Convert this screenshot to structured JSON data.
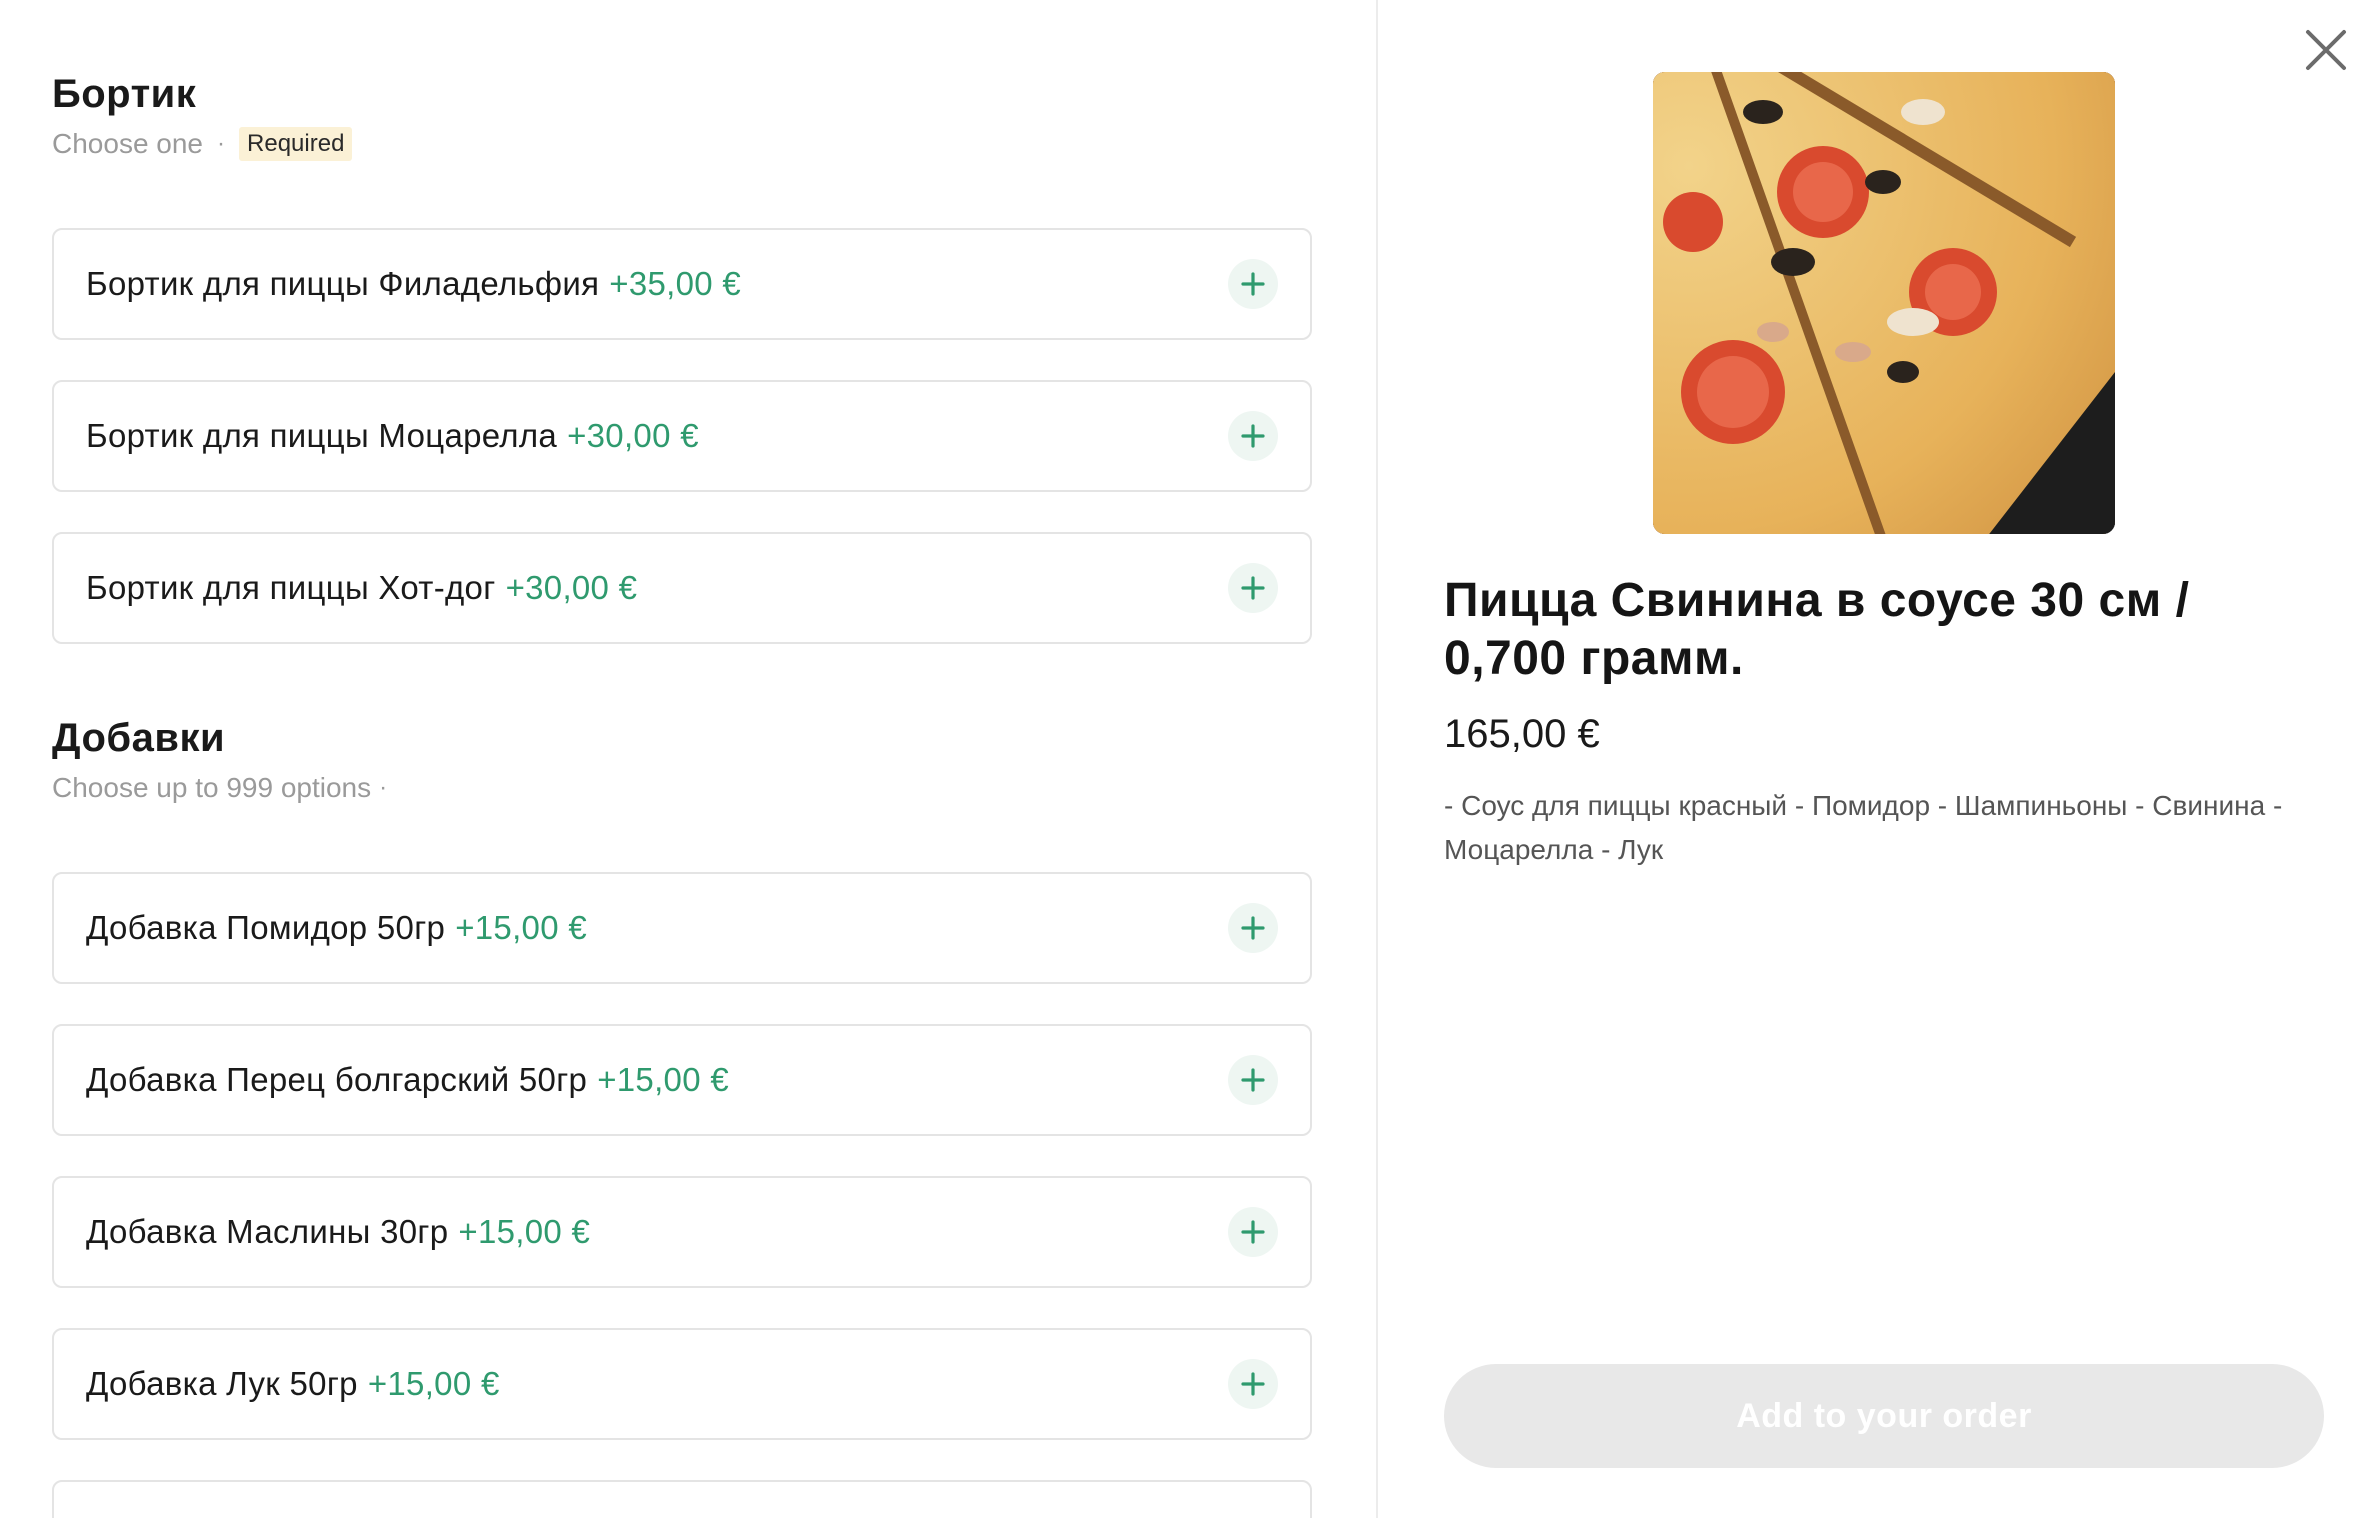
{
  "groups": [
    {
      "title": "Бортик",
      "subtitle": "Choose one",
      "badge": "Required",
      "options": [
        {
          "label": "Бортик для пиццы Филадельфия",
          "price": "+35,00 €"
        },
        {
          "label": "Бортик для пиццы Моцарелла",
          "price": "+30,00 €"
        },
        {
          "label": "Бортик для пиццы Хот-дог",
          "price": "+30,00 €"
        }
      ]
    },
    {
      "title": "Добавки",
      "subtitle": "Choose up to 999 options",
      "options": [
        {
          "label": "Добавка Помидор 50гр",
          "price": "+15,00 €"
        },
        {
          "label": "Добавка Перец болгарский 50гр",
          "price": "+15,00 €"
        },
        {
          "label": "Добавка Маслины 30гр",
          "price": "+15,00 €"
        },
        {
          "label": "Добавка Лук 50гр",
          "price": "+15,00 €"
        }
      ]
    }
  ],
  "product": {
    "title": "Пицца Свинина в соусе 30 см / 0,700 грамм.",
    "price": "165,00 €",
    "description": "- Соус для пиццы красный - Помидор - Шампиньоны - Свинина - Моцарелла - Лук"
  },
  "actions": {
    "add_to_order": "Add to your order"
  },
  "icons": {
    "close": "close-icon",
    "plus": "plus-icon"
  },
  "colors": {
    "accent_green": "#2f9a6e",
    "plus_bg": "#eef6f2",
    "badge_bg": "#fbf1d6",
    "disabled_button": "#e8e8e8"
  }
}
